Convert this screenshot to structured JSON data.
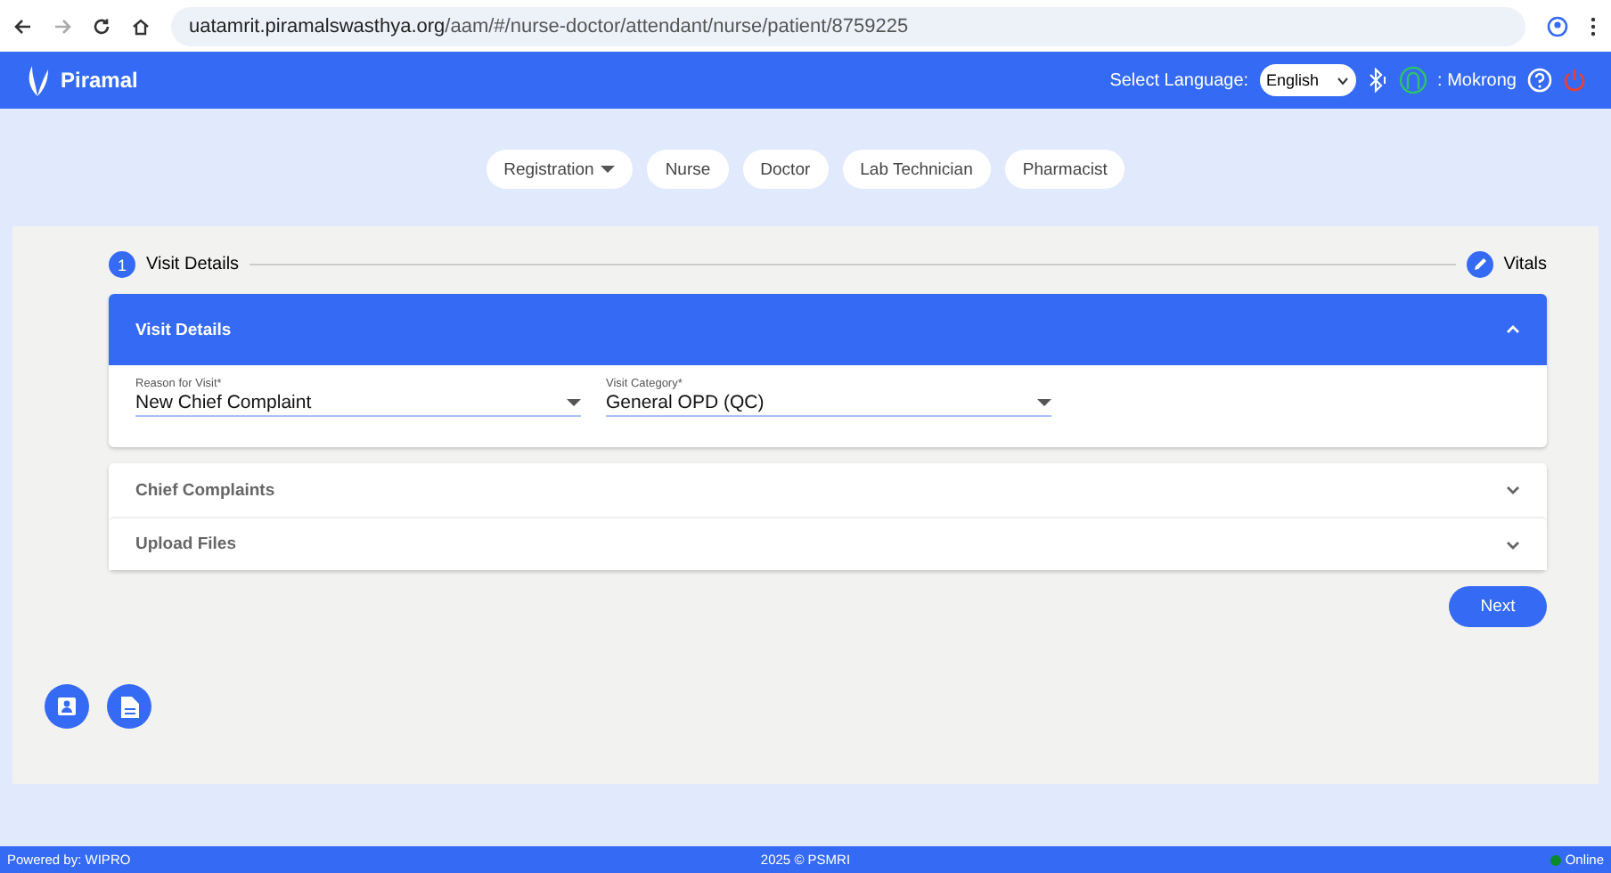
{
  "browser": {
    "url_host": "uatamrit.piramalswasthya.org",
    "url_path": "/aam/#/nurse-doctor/attendant/nurse/patient/8759225"
  },
  "header": {
    "logo": "Piramal",
    "language_label": "Select Language:",
    "language": "English",
    "user": ": Mokrong"
  },
  "role_tabs": [
    {
      "label": "Registration",
      "has_menu": true
    },
    {
      "label": "Nurse",
      "has_menu": false
    },
    {
      "label": "Doctor",
      "has_menu": false
    },
    {
      "label": "Lab Technician",
      "has_menu": false
    },
    {
      "label": "Pharmacist",
      "has_menu": false
    }
  ],
  "stepper": [
    {
      "label": "Visit Details",
      "kind": "number",
      "number": "1"
    },
    {
      "label": "Vitals",
      "kind": "edit"
    }
  ],
  "panels": [
    {
      "title": "Visit Details",
      "expanded": true,
      "fields": [
        {
          "label": "Reason for Visit*",
          "value": "New Chief Complaint"
        },
        {
          "label": "Visit Category*",
          "value": "General OPD (QC)"
        }
      ]
    },
    {
      "title": "Chief Complaints",
      "expanded": false
    },
    {
      "title": "Upload Files",
      "expanded": false
    }
  ],
  "next_button": "Next",
  "footer": {
    "left": "Powered by: WIPRO",
    "center": "2025 © PSMRI",
    "status": "Online",
    "online": true
  }
}
